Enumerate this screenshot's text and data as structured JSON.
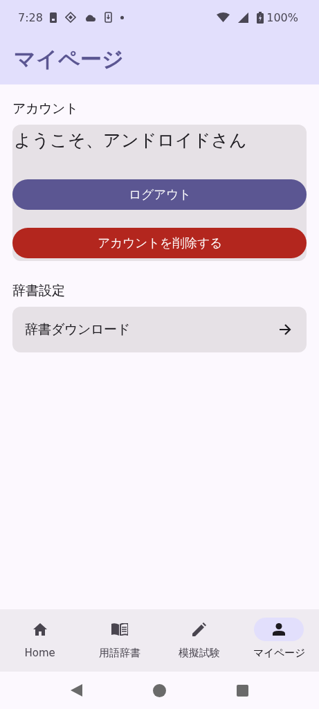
{
  "status_bar": {
    "time": "7:28",
    "battery": "100%"
  },
  "app_bar": {
    "title": "マイページ"
  },
  "account": {
    "heading": "アカウント",
    "greeting": "ようこそ、アンドロイドさん",
    "buttons": [
      {
        "label": "ログアウト",
        "kind": "primary"
      },
      {
        "label": "アカウントを削除する",
        "kind": "danger"
      }
    ]
  },
  "dictionary": {
    "heading": "辞書設定",
    "items": [
      {
        "label": "辞書ダウンロード"
      }
    ]
  },
  "bottom_nav": [
    {
      "label": "Home",
      "kind": "home",
      "selected": false
    },
    {
      "label": "用語辞書",
      "kind": "book",
      "selected": false
    },
    {
      "label": "模擬試験",
      "kind": "pencil",
      "selected": false
    },
    {
      "label": "マイページ",
      "kind": "person",
      "selected": true
    }
  ]
}
